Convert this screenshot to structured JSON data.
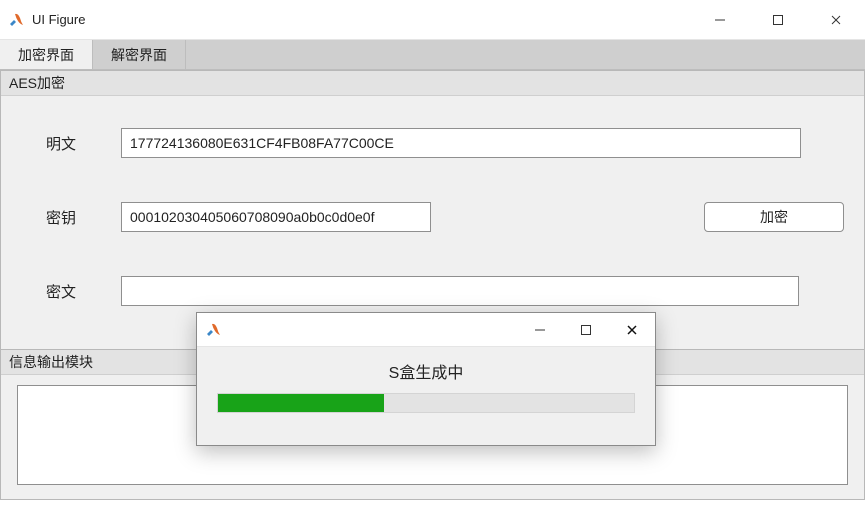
{
  "window": {
    "title": "UI Figure"
  },
  "tabs": {
    "encrypt": "加密界面",
    "decrypt": "解密界面"
  },
  "aes_panel": {
    "title": "AES加密",
    "plain_label": "明文",
    "plain_value": "177724136080E631CF4FB08FA77C00CE",
    "key_label": "密钥",
    "key_value": "000102030405060708090a0b0c0d0e0f",
    "encrypt_button": "加密",
    "cipher_label": "密文",
    "cipher_value": ""
  },
  "log_panel": {
    "title": "信息输出模块"
  },
  "progress_dialog": {
    "message": "S盒生成中",
    "percent": 40
  }
}
